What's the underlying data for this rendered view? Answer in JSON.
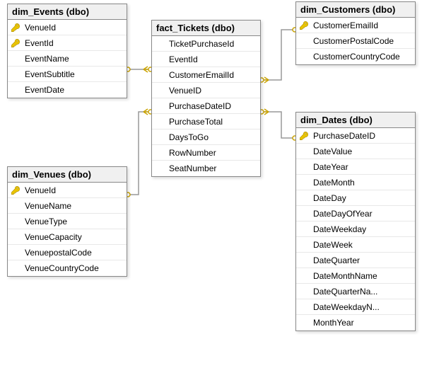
{
  "tables": {
    "dim_Events": {
      "title": "dim_Events (dbo)",
      "columns": [
        {
          "name": "VenueId",
          "pk": true
        },
        {
          "name": "EventId",
          "pk": true
        },
        {
          "name": "EventName",
          "pk": false
        },
        {
          "name": "EventSubtitle",
          "pk": false
        },
        {
          "name": "EventDate",
          "pk": false
        }
      ]
    },
    "fact_Tickets": {
      "title": "fact_Tickets (dbo)",
      "columns": [
        {
          "name": "TicketPurchaseId",
          "pk": false
        },
        {
          "name": "EventId",
          "pk": false
        },
        {
          "name": "CustomerEmailId",
          "pk": false
        },
        {
          "name": "VenueID",
          "pk": false
        },
        {
          "name": "PurchaseDateID",
          "pk": false
        },
        {
          "name": "PurchaseTotal",
          "pk": false
        },
        {
          "name": "DaysToGo",
          "pk": false
        },
        {
          "name": "RowNumber",
          "pk": false
        },
        {
          "name": "SeatNumber",
          "pk": false
        }
      ]
    },
    "dim_Customers": {
      "title": "dim_Customers (dbo)",
      "columns": [
        {
          "name": "CustomerEmailId",
          "pk": true
        },
        {
          "name": "CustomerPostalCode",
          "pk": false
        },
        {
          "name": "CustomerCountryCode",
          "pk": false
        }
      ]
    },
    "dim_Venues": {
      "title": "dim_Venues (dbo)",
      "columns": [
        {
          "name": "VenueId",
          "pk": true
        },
        {
          "name": "VenueName",
          "pk": false
        },
        {
          "name": "VenueType",
          "pk": false
        },
        {
          "name": "VenueCapacity",
          "pk": false
        },
        {
          "name": "VenuepostalCode",
          "pk": false
        },
        {
          "name": "VenueCountryCode",
          "pk": false
        }
      ]
    },
    "dim_Dates": {
      "title": "dim_Dates (dbo)",
      "columns": [
        {
          "name": "PurchaseDateID",
          "pk": true
        },
        {
          "name": "DateValue",
          "pk": false
        },
        {
          "name": "DateYear",
          "pk": false
        },
        {
          "name": "DateMonth",
          "pk": false
        },
        {
          "name": "DateDay",
          "pk": false
        },
        {
          "name": "DateDayOfYear",
          "pk": false
        },
        {
          "name": "DateWeekday",
          "pk": false
        },
        {
          "name": "DateWeek",
          "pk": false
        },
        {
          "name": "DateQuarter",
          "pk": false
        },
        {
          "name": "DateMonthName",
          "pk": false
        },
        {
          "name": "DateQuarterNa...",
          "pk": false
        },
        {
          "name": "DateWeekdayN...",
          "pk": false
        },
        {
          "name": "MonthYear",
          "pk": false
        }
      ]
    }
  },
  "relationships": [
    {
      "from": "fact_Tickets.EventId",
      "to": "dim_Events.EventId"
    },
    {
      "from": "fact_Tickets.CustomerEmailId",
      "to": "dim_Customers.CustomerEmailId"
    },
    {
      "from": "fact_Tickets.VenueID",
      "to": "dim_Venues.VenueId"
    },
    {
      "from": "fact_Tickets.PurchaseDateID",
      "to": "dim_Dates.PurchaseDateID"
    }
  ]
}
